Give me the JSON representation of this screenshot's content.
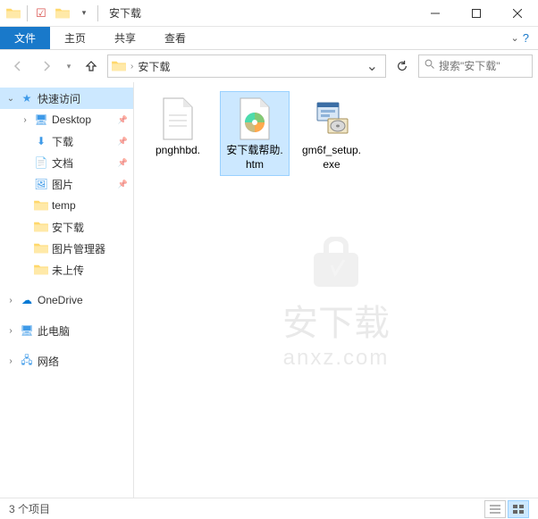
{
  "window": {
    "title": "安下载"
  },
  "ribbon": {
    "file": "文件",
    "home": "主页",
    "share": "共享",
    "view": "查看"
  },
  "address": {
    "current": "安下载"
  },
  "nav": {
    "refresh": "刷新"
  },
  "search": {
    "placeholder": "搜索\"安下载\""
  },
  "tree": {
    "quick_access": "快速访问",
    "desktop": "Desktop",
    "downloads": "下载",
    "documents": "文档",
    "pictures": "图片",
    "temp": "temp",
    "anxiazai": "安下载",
    "picmgr": "图片管理器",
    "notup": "未上传",
    "onedrive": "OneDrive",
    "thispc": "此电脑",
    "network": "网络"
  },
  "files": [
    {
      "name": "pnghhbd.",
      "type": "document",
      "selected": false
    },
    {
      "name": "安下载帮助.htm",
      "type": "html",
      "selected": true
    },
    {
      "name": "gm6f_setup.exe",
      "type": "exe",
      "selected": false
    }
  ],
  "status": {
    "count": "3 个项目"
  },
  "watermark": {
    "cn": "安下载",
    "en": "anxz.com"
  }
}
